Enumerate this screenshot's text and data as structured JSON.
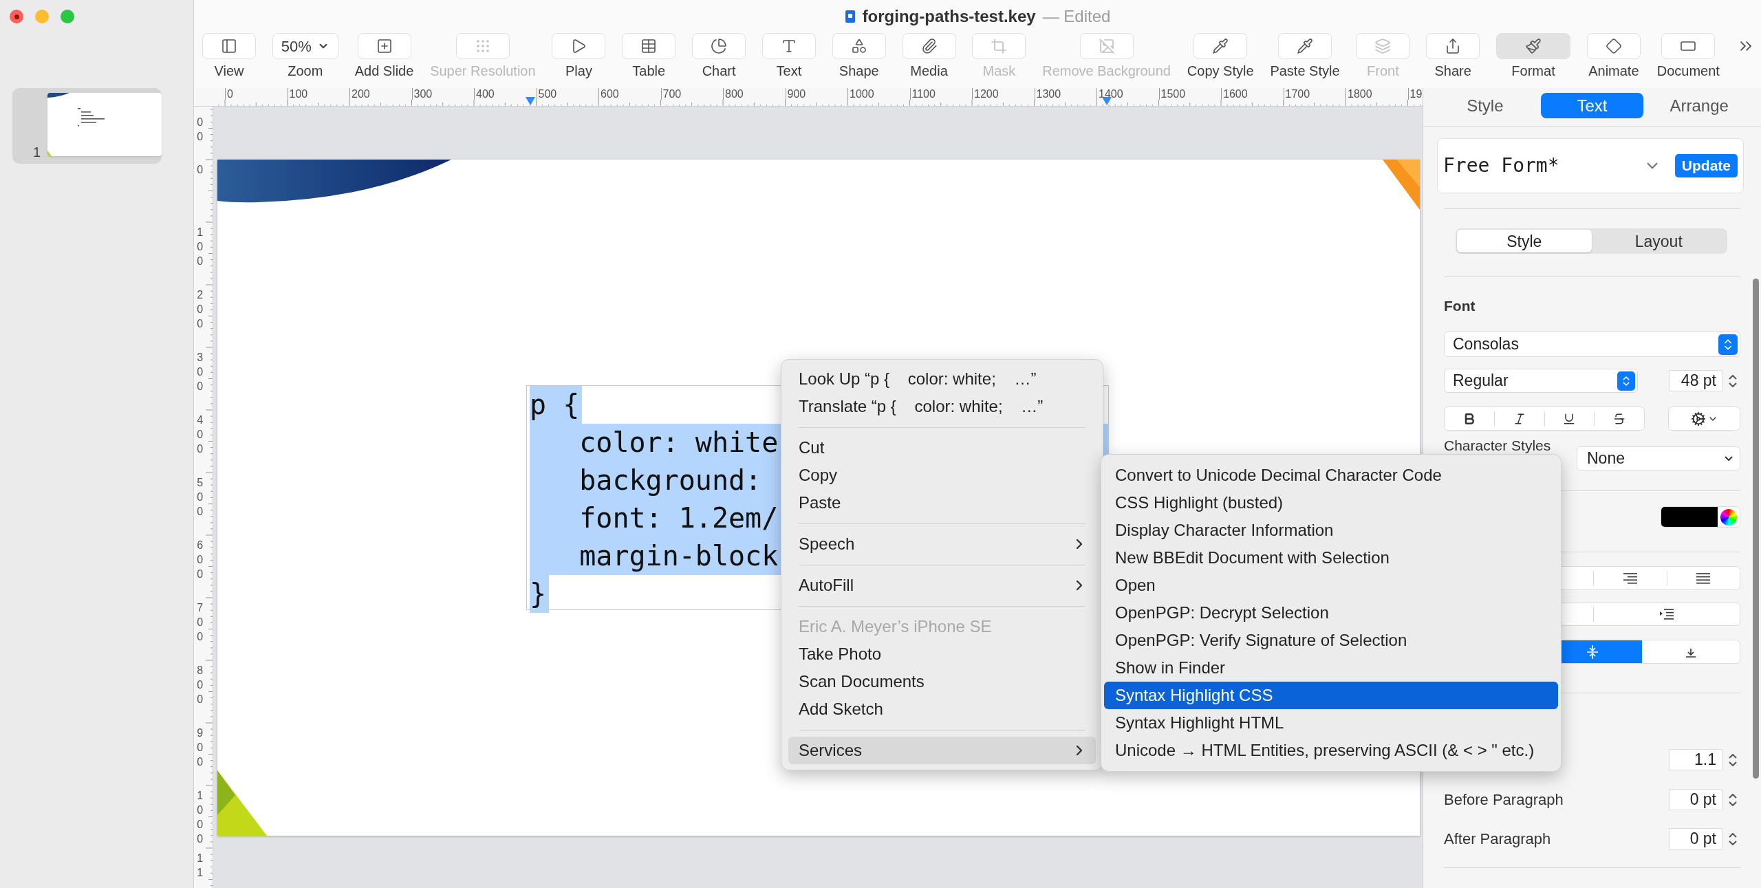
{
  "window": {
    "title": "forging-paths-test.key",
    "status": "— Edited"
  },
  "sidebar": {
    "slides": [
      {
        "number": "1",
        "selected": true
      }
    ]
  },
  "toolbar": [
    {
      "label": "View",
      "disabled": false,
      "selected": false
    },
    {
      "label": "Zoom",
      "value": "50%",
      "disabled": false,
      "selected": false
    },
    {
      "label": "Add Slide",
      "disabled": false,
      "selected": false
    },
    {
      "label": "Super Resolution",
      "disabled": true,
      "selected": false
    },
    {
      "label": "Play",
      "disabled": false,
      "selected": false
    },
    {
      "label": "Table",
      "disabled": false,
      "selected": false
    },
    {
      "label": "Chart",
      "disabled": false,
      "selected": false
    },
    {
      "label": "Text",
      "disabled": false,
      "selected": false
    },
    {
      "label": "Shape",
      "disabled": false,
      "selected": false
    },
    {
      "label": "Media",
      "disabled": false,
      "selected": false
    },
    {
      "label": "Mask",
      "disabled": true,
      "selected": false
    },
    {
      "label": "Remove Background",
      "disabled": true,
      "selected": false
    },
    {
      "label": "Copy Style",
      "disabled": false,
      "selected": false
    },
    {
      "label": "Paste Style",
      "disabled": false,
      "selected": false
    },
    {
      "label": "Front",
      "disabled": true,
      "selected": false
    },
    {
      "label": "Share",
      "disabled": false,
      "selected": false
    },
    {
      "label": "Format",
      "disabled": false,
      "selected": true
    },
    {
      "label": "Animate",
      "disabled": false,
      "selected": false
    },
    {
      "label": "Document",
      "disabled": false,
      "selected": false
    }
  ],
  "ruler": {
    "horizontal": [
      "0",
      "100",
      "200",
      "300",
      "400",
      "500",
      "600",
      "700",
      "800",
      "900",
      "1000",
      "1100",
      "1200",
      "1300",
      "1400",
      "1500",
      "1600",
      "1700",
      "1800",
      "19"
    ],
    "vertical": [
      "00",
      "0",
      "100",
      "200",
      "300",
      "400",
      "500",
      "600",
      "700",
      "800",
      "900",
      "1000",
      "11"
    ]
  },
  "slide": {
    "code_lines": [
      {
        "text": "p {",
        "selected": true
      },
      {
        "text": "   color: white",
        "selected": true
      },
      {
        "text": "   background:",
        "selected": true
      },
      {
        "text": "   font: 1.2em/",
        "selected": true
      },
      {
        "text": "   margin-block",
        "selected": true
      },
      {
        "text": "}",
        "selected": true
      }
    ]
  },
  "context_menu": {
    "items": [
      {
        "kind": "item",
        "label": "Look Up “p {    color: white;    …”",
        "submenu": false,
        "disabled": false,
        "selected": false
      },
      {
        "kind": "item",
        "label": "Translate “p {    color: white;    …”",
        "submenu": false,
        "disabled": false,
        "selected": false
      },
      {
        "kind": "separator"
      },
      {
        "kind": "item",
        "label": "Cut",
        "submenu": false,
        "disabled": false,
        "selected": false
      },
      {
        "kind": "item",
        "label": "Copy",
        "submenu": false,
        "disabled": false,
        "selected": false
      },
      {
        "kind": "item",
        "label": "Paste",
        "submenu": false,
        "disabled": false,
        "selected": false
      },
      {
        "kind": "separator"
      },
      {
        "kind": "item",
        "label": "Speech",
        "submenu": true,
        "disabled": false,
        "selected": false
      },
      {
        "kind": "separator"
      },
      {
        "kind": "item",
        "label": "AutoFill",
        "submenu": true,
        "disabled": false,
        "selected": false
      },
      {
        "kind": "separator"
      },
      {
        "kind": "item",
        "label": "Eric A. Meyer’s iPhone SE",
        "submenu": false,
        "disabled": true,
        "selected": false
      },
      {
        "kind": "item",
        "label": "Take Photo",
        "submenu": false,
        "disabled": false,
        "selected": false
      },
      {
        "kind": "item",
        "label": "Scan Documents",
        "submenu": false,
        "disabled": false,
        "selected": false
      },
      {
        "kind": "item",
        "label": "Add Sketch",
        "submenu": false,
        "disabled": false,
        "selected": false
      },
      {
        "kind": "separator"
      },
      {
        "kind": "item",
        "label": "Services",
        "submenu": true,
        "disabled": false,
        "selected": true
      }
    ]
  },
  "services_menu": {
    "items": [
      {
        "label": "Convert to Unicode Decimal Character Code",
        "selected": false
      },
      {
        "label": "CSS Highlight (busted)",
        "selected": false
      },
      {
        "label": "Display Character Information",
        "selected": false
      },
      {
        "label": "New BBEdit Document with Selection",
        "selected": false
      },
      {
        "label": "Open",
        "selected": false
      },
      {
        "label": "OpenPGP: Decrypt Selection",
        "selected": false
      },
      {
        "label": "OpenPGP: Verify Signature of Selection",
        "selected": false
      },
      {
        "label": "Show in Finder",
        "selected": false
      },
      {
        "label": "Syntax Highlight CSS",
        "selected": true
      },
      {
        "label": "Syntax Highlight HTML",
        "selected": false
      },
      {
        "label": "Unicode → HTML Entities, preserving ASCII (& < > \" etc.)",
        "selected": false
      }
    ]
  },
  "inspector": {
    "tabs": [
      {
        "label": "Style",
        "selected": false
      },
      {
        "label": "Text",
        "selected": true
      },
      {
        "label": "Arrange",
        "selected": false
      }
    ],
    "paragraph_style": {
      "name": "Free Form*",
      "button": "Update"
    },
    "mode_tabs": [
      {
        "label": "Style",
        "selected": true
      },
      {
        "label": "Layout",
        "selected": false
      }
    ],
    "font": {
      "heading": "Font",
      "family": "Consolas",
      "typeface": "Regular",
      "size": "48 pt"
    },
    "character_styles": {
      "label": "Character Styles",
      "value": "None"
    },
    "vertical_alignment": [
      {
        "kind": "middle",
        "selected": true
      },
      {
        "kind": "bottom",
        "selected": false
      }
    ],
    "spacing": {
      "value": "1.1"
    },
    "before_paragraph": {
      "label": "Before Paragraph",
      "value": "0 pt"
    },
    "after_paragraph": {
      "label": "After Paragraph",
      "value": "0 pt"
    }
  }
}
